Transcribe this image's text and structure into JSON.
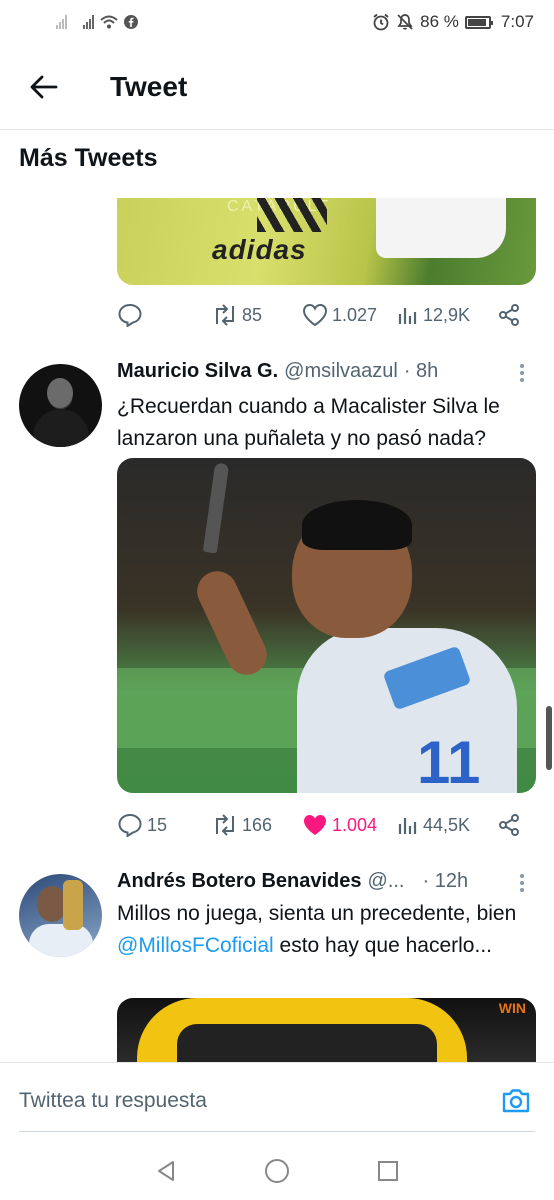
{
  "status_bar": {
    "battery": "86 %",
    "time": "7:07",
    "icons": [
      "signal-icon",
      "wifi-icon",
      "facebook-icon",
      "alarm-icon",
      "mute-icon",
      "battery-icon"
    ]
  },
  "header": {
    "title": "Tweet",
    "back_icon": "arrow-left-icon"
  },
  "section_title": "Más Tweets",
  "tweets": [
    {
      "image_caption": "adidas",
      "image_top_text": "CATAPULT",
      "replies": "",
      "retweets": "85",
      "likes": "1.027",
      "views": "12,9K"
    },
    {
      "name": "Mauricio Silva G.",
      "handle": "@msilvaazul",
      "time": "· 8h",
      "text": "¿Recuerdan cuando a Macalister Silva le lanzaron una puñaleta y no pasó nada?",
      "image_number": "11",
      "replies": "15",
      "retweets": "166",
      "likes": "1.004",
      "liked": true,
      "views": "44,5K"
    },
    {
      "name": "Andrés Botero Benavides",
      "handle": "@...",
      "time": "· 12h",
      "text_before": "Millos no juega, sienta un precedente, bien",
      "mention": "@MillosFCoficial",
      "text_after": " esto hay que hacerlo...",
      "image_sign": "WIN"
    }
  ],
  "reply_bar": {
    "placeholder": "Twittea tu respuesta",
    "camera_icon": "camera-icon"
  },
  "colors": {
    "accent": "#1d9bf0",
    "like": "#f91880",
    "muted": "#536471"
  }
}
